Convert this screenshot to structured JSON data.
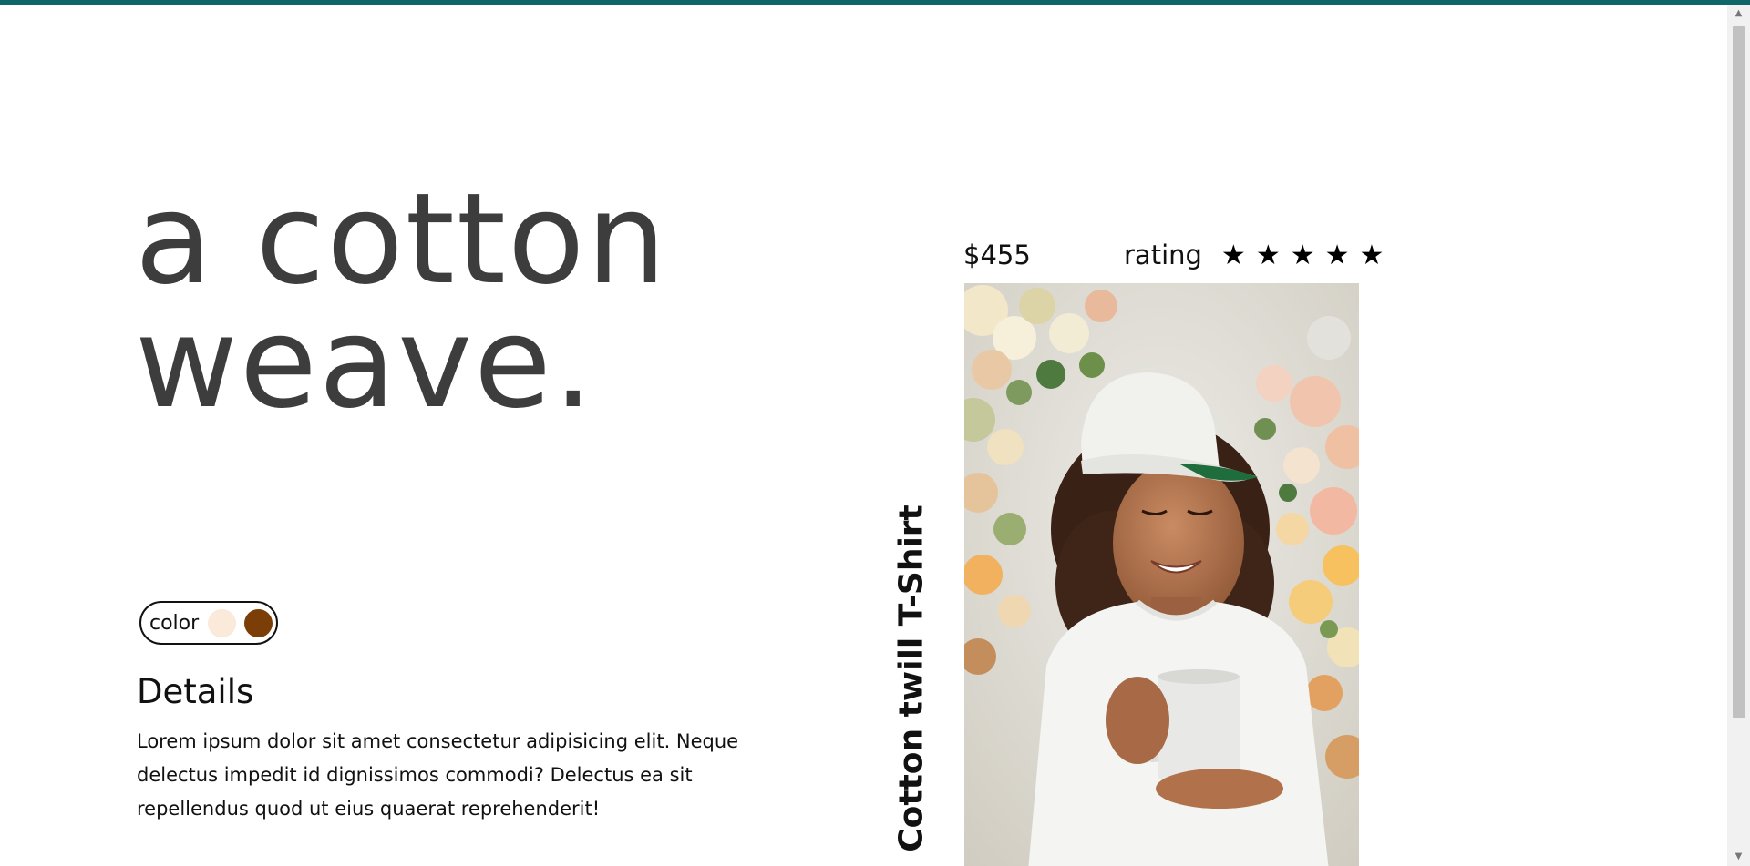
{
  "hero": {
    "line1": "a cotton",
    "line2": "weave."
  },
  "color_picker": {
    "label": "color",
    "options": [
      {
        "name": "cream",
        "hex": "#fbe9da"
      },
      {
        "name": "brown",
        "hex": "#7a3e06"
      }
    ]
  },
  "details": {
    "title": "Details",
    "body": "Lorem ipsum dolor sit amet consectetur adipisicing elit. Neque delectus impedit id dignissimos commodi? Delectus ea sit repellendus quod ut eius quaerat reprehenderit!"
  },
  "product": {
    "price": "$455",
    "rating_label": "rating",
    "rating_stars": 5,
    "star_glyph": "★",
    "name": "Cotton twill T-Shirt",
    "photo_icon": "model-photo"
  },
  "colors": {
    "accent_bar": "#0f6669",
    "headline_text": "#3d3d3d",
    "body_text": "#111111"
  },
  "scrollbar": {
    "up_arrow": "▲",
    "down_arrow": "▼"
  }
}
